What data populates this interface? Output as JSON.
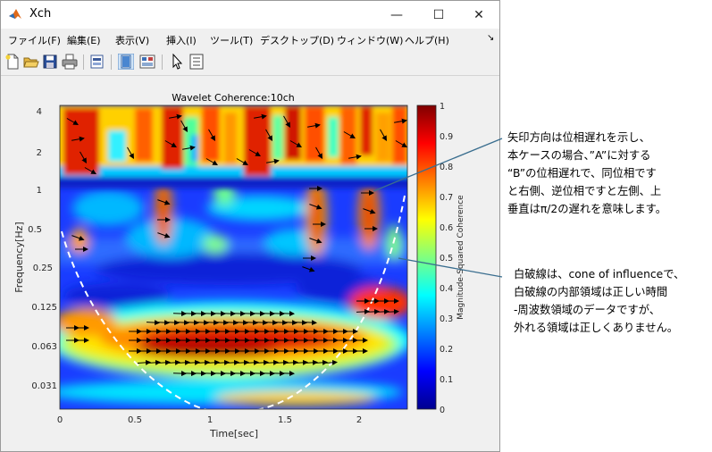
{
  "window": {
    "title": "Xch",
    "minimize_glyph": "—",
    "maximize_glyph": "☐",
    "close_glyph": "✕"
  },
  "menu": {
    "items": [
      "ファイル(F)",
      "編集(E)",
      "表示(V)",
      "挿入(I)",
      "ツール(T)",
      "デスクトップ(D)",
      "ウィンドウ(W)",
      "ヘルプ(H)"
    ],
    "dock_glyph": "↘"
  },
  "toolbar": {
    "icons": [
      "new-figure-icon",
      "open-file-icon",
      "save-icon",
      "print-icon",
      "print-preview-icon",
      "hide-plot-tools-icon",
      "show-plot-tools-icon",
      "edit-plot-cursor-icon",
      "property-inspector-icon"
    ]
  },
  "chart_data": {
    "type": "heatmap",
    "title": "Wavelet Coherence:10ch",
    "xlabel": "Time[sec]",
    "ylabel": "Frequency[Hz]",
    "colorbar_label": "Magnitude-Squared Coherence",
    "colormap": "jet",
    "x_ticks": [
      "0",
      "0.5",
      "1",
      "1.5",
      "2"
    ],
    "x_tick_values": [
      0,
      0.5,
      1,
      1.5,
      2
    ],
    "xlim": [
      0,
      2.3
    ],
    "y_scale": "log",
    "y_ticks": [
      "4",
      "2",
      "1",
      "0.5",
      "0.25",
      "0.125",
      "0.063",
      "0.031"
    ],
    "y_tick_values": [
      4,
      2,
      1,
      0.5,
      0.25,
      0.125,
      0.063,
      0.031
    ],
    "ylim": [
      0.022,
      4.3
    ],
    "colorbar_ticks": [
      "0",
      "0.1",
      "0.2",
      "0.3",
      "0.4",
      "0.5",
      "0.6",
      "0.7",
      "0.8",
      "0.9",
      "1"
    ],
    "colorbar_tick_values": [
      0,
      0.1,
      0.2,
      0.3,
      0.4,
      0.5,
      0.6,
      0.7,
      0.8,
      0.9,
      1
    ],
    "clim": [
      0,
      1
    ],
    "cone_of_influence": "white dashed line",
    "high_coherence_regions": [
      {
        "t_range": [
          0,
          2.3
        ],
        "f_range": [
          1.2,
          4.3
        ],
        "level": 0.9
      },
      {
        "t_range": [
          0.3,
          2.0
        ],
        "f_range": [
          0.04,
          0.13
        ],
        "level": 0.95
      },
      {
        "t_range": [
          1.9,
          2.3
        ],
        "f_range": [
          0.06,
          0.15
        ],
        "level": 0.9
      },
      {
        "t_range": [
          0.05,
          0.3
        ],
        "f_range": [
          0.06,
          0.12
        ],
        "level": 0.85
      },
      {
        "t_range": [
          0.62,
          0.75
        ],
        "f_range": [
          0.4,
          1.0
        ],
        "level": 0.85
      },
      {
        "t_range": [
          1.65,
          1.75
        ],
        "f_range": [
          0.3,
          1.0
        ],
        "level": 0.85
      },
      {
        "t_range": [
          2.0,
          2.1
        ],
        "f_range": [
          0.4,
          0.9
        ],
        "level": 0.85
      }
    ],
    "phase_arrows": "arrows mostly pointing right (in-phase) in high-coherence regions"
  },
  "annotations": {
    "arrow_note": [
      "矢印方向は位相遅れを示し、",
      "本ケースの場合、”A”に対する",
      "“B”の位相遅れで、同位相です",
      "と右側、逆位相ですと左側、上",
      "垂直はπ/2の遅れを意味します。"
    ],
    "coi_note": [
      "白破線は、cone of influenceで、",
      "白破線の内部領域は正しい時間",
      "-周波数領域のデータですが、",
      "外れる領域は正しくありません。"
    ],
    "callout_color": "#3a6e8f"
  }
}
